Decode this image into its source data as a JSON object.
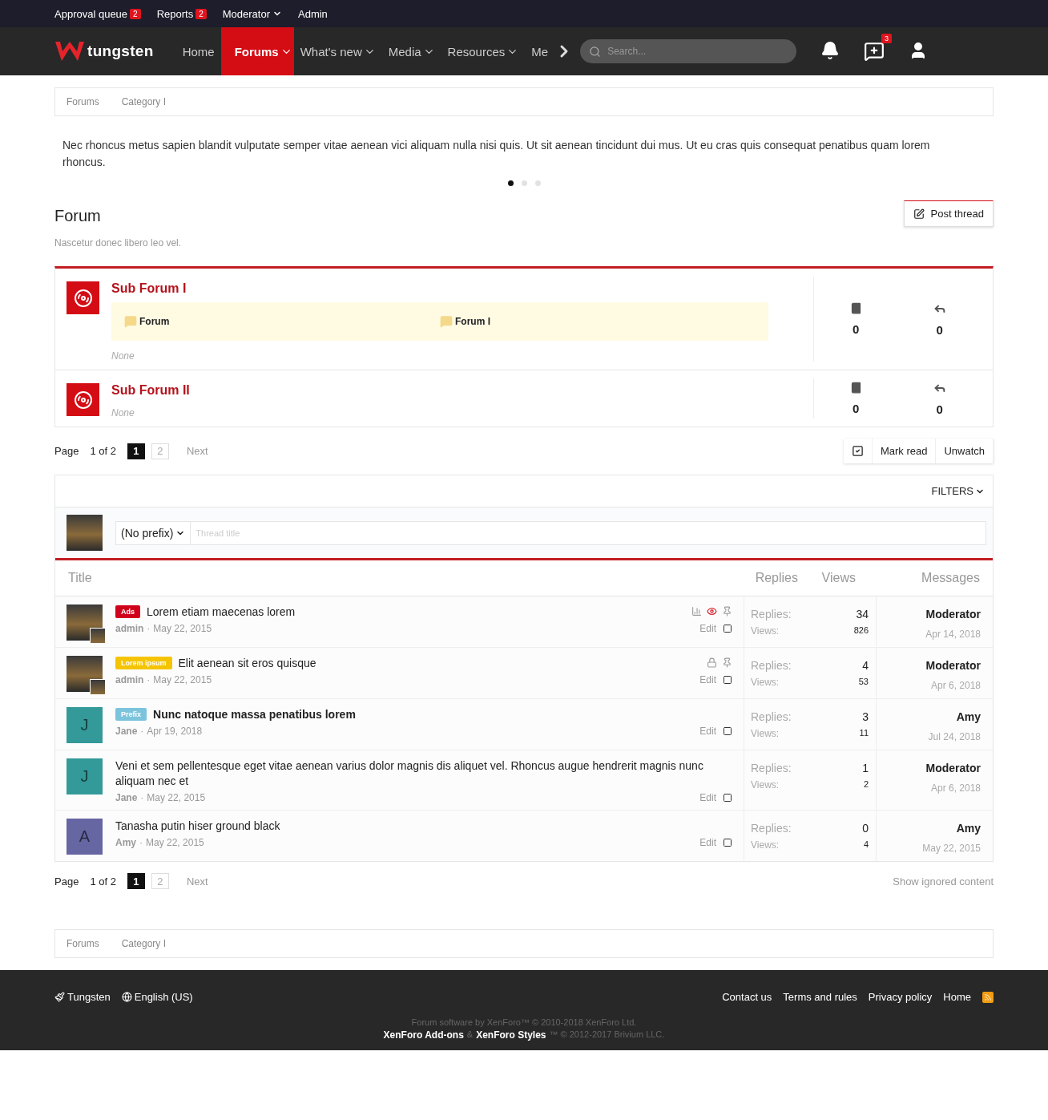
{
  "staff_bar": [
    {
      "label": "Approval queue",
      "count": "2",
      "menu": false
    },
    {
      "label": "Reports",
      "count": "2",
      "menu": false
    },
    {
      "label": "Moderator",
      "menu": true
    },
    {
      "label": "Admin",
      "menu": false
    }
  ],
  "nav": {
    "logo": "tungsten",
    "items": [
      {
        "label": "Home",
        "selected": false,
        "menu": false
      },
      {
        "label": "Forums",
        "selected": true,
        "menu": true
      },
      {
        "label": "What's new",
        "selected": false,
        "menu": true
      },
      {
        "label": "Media",
        "selected": false,
        "menu": true
      },
      {
        "label": "Resources",
        "selected": false,
        "menu": true
      },
      {
        "label": "Me",
        "selected": false,
        "menu": false
      }
    ],
    "search_placeholder": "Search...",
    "conversations_badge": "3"
  },
  "breadcrumbs": [
    "Forums",
    "Category I"
  ],
  "notice": {
    "text": "Nec rhoncus metus sapien blandit vulputate semper vitae aenean vici aliquam nulla nisi quis. Ut sit aenean tincidunt dui mus. Ut eu cras quis consequat penatibus quam lorem rhoncus.",
    "dots": [
      {
        "selected": true
      },
      {
        "selected": false
      },
      {
        "selected": false
      }
    ]
  },
  "forum": {
    "title": "Forum",
    "description": "Nascetur donec libero leo vel.",
    "post_button": "Post thread"
  },
  "subforums": [
    {
      "title": "Sub Forum I",
      "links": [
        "Forum",
        "Forum I"
      ],
      "last": "None",
      "threads": "0",
      "messages": "0"
    },
    {
      "title": "Sub Forum II",
      "last": "None",
      "threads": "0",
      "messages": "0"
    }
  ],
  "pagination": {
    "label": "Page",
    "summary": "1 of 2",
    "pages": [
      {
        "label": "1",
        "selected": true
      },
      {
        "label": "2",
        "selected": false
      }
    ],
    "next": "Next"
  },
  "actions": [
    "Mark read",
    "Unwatch"
  ],
  "filters": "FILTERS",
  "quick_thread": {
    "prefix": "(No prefix)",
    "placeholder": "Thread title"
  },
  "columns": [
    "Title",
    "Replies",
    "Views",
    "Messages"
  ],
  "threads": [
    {
      "prefix": {
        "label": "Ads",
        "color": "#d0021b"
      },
      "title": "Lorem etiam maecenas lorem",
      "unread": false,
      "stats": true,
      "watched": true,
      "locked": false,
      "sticky": true,
      "avatar": {
        "kind": "photo"
      },
      "author": "admin",
      "separator": "·",
      "date": "May 22, 2015",
      "edit": "Edit",
      "selected": false,
      "replies_label": "Replies:",
      "replies": "34",
      "views_label": "Views:",
      "views": "826",
      "last_user": "Moderator",
      "last_date": "Apr 14, 2018"
    },
    {
      "prefix": {
        "label": "Lorem ipsum",
        "color": "#f5c400"
      },
      "title": "Elit aenean sit eros quisque",
      "unread": false,
      "stats": false,
      "watched": false,
      "locked": true,
      "sticky": true,
      "avatar": {
        "kind": "photo"
      },
      "author": "admin",
      "separator": "·",
      "date": "May 22, 2015",
      "edit": "Edit",
      "selected": false,
      "replies_label": "Replies:",
      "replies": "4",
      "views_label": "Views:",
      "views": "53",
      "last_user": "Moderator",
      "last_date": "Apr 6, 2018"
    },
    {
      "prefix": {
        "label": "Prefix",
        "color": "#7cc4dc"
      },
      "title": "Nunc natoque massa penatibus lorem",
      "unread": true,
      "stats": false,
      "watched": false,
      "locked": false,
      "sticky": false,
      "avatar": {
        "kind": "letter",
        "letter": "J",
        "color": "#339999"
      },
      "author": "Jane",
      "separator": "·",
      "date": "Apr 19, 2018",
      "edit": "Edit",
      "selected": false,
      "replies_label": "Replies:",
      "replies": "3",
      "views_label": "Views:",
      "views": "11",
      "last_user": "Amy",
      "last_date": "Jul 24, 2018"
    },
    {
      "title": "Veni et sem pellentesque eget vitae aenean varius dolor magnis dis aliquet vel. Rhoncus augue hendrerit magnis nunc aliquam nec et",
      "unread": false,
      "stats": false,
      "watched": false,
      "locked": false,
      "sticky": false,
      "avatar": {
        "kind": "letter",
        "letter": "J",
        "color": "#339999"
      },
      "author": "Jane",
      "separator": "·",
      "date": "May 22, 2015",
      "edit": "Edit",
      "selected": false,
      "replies_label": "Replies:",
      "replies": "1",
      "views_label": "Views:",
      "views": "2",
      "last_user": "Moderator",
      "last_date": "Apr 6, 2018"
    },
    {
      "title": "Tanasha putin hiser ground black",
      "unread": false,
      "stats": false,
      "watched": false,
      "locked": false,
      "sticky": false,
      "avatar": {
        "kind": "letter",
        "letter": "A",
        "color": "#6666a3"
      },
      "author": "Amy",
      "separator": "·",
      "date": "May 22, 2015",
      "edit": "Edit",
      "selected": false,
      "replies_label": "Replies:",
      "replies": "0",
      "views_label": "Views:",
      "views": "4",
      "last_user": "Amy",
      "last_date": "May 22, 2015"
    }
  ],
  "bottom_pagination": {
    "label": "Page",
    "summary": "1 of 2",
    "pages": [
      {
        "label": "1",
        "selected": true
      },
      {
        "label": "2",
        "selected": false
      }
    ],
    "next": "Next"
  },
  "show_ignored": "Show ignored content",
  "bottom_breadcrumbs": [
    "Forums",
    "Category I"
  ],
  "footer": {
    "style": "Tungsten",
    "language": "English (US)",
    "links": [
      "Contact us",
      "Terms and rules",
      "Privacy policy",
      "Home"
    ],
    "copyright": "Forum software by XenForo™ © 2010-2018 XenForo Ltd.",
    "credits": [
      {
        "text": "XenForo Add-ons",
        "link": true
      },
      {
        "text": "&",
        "link": false
      },
      {
        "text": "XenForo Styles",
        "link": true
      },
      {
        "text": "™ © 2012-2017 Brivium LLC.",
        "link": false
      }
    ]
  }
}
